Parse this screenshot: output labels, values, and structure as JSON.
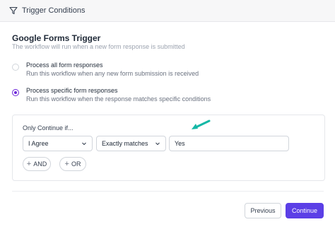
{
  "header": {
    "title": "Trigger Conditions",
    "icon": "filter-icon"
  },
  "section": {
    "title": "Google Forms Trigger",
    "subtitle": "The workflow will run when a new form response is submitted"
  },
  "options": [
    {
      "label": "Process all form responses",
      "description": "Run this workflow when any new form submission is received",
      "selected": false
    },
    {
      "label": "Process specific form responses",
      "description": "Run this workflow when the response matches specific conditions",
      "selected": true
    }
  ],
  "condition": {
    "label": "Only Continue if...",
    "field": "I Agree",
    "operator": "Exactly matches",
    "value": "Yes",
    "and_label": "AND",
    "or_label": "OR"
  },
  "footer": {
    "previous_label": "Previous",
    "continue_label": "Continue"
  },
  "colors": {
    "accent": "#5b3fe6",
    "arrow": "#14b8a6",
    "radio_selected": "#6d28d9"
  }
}
